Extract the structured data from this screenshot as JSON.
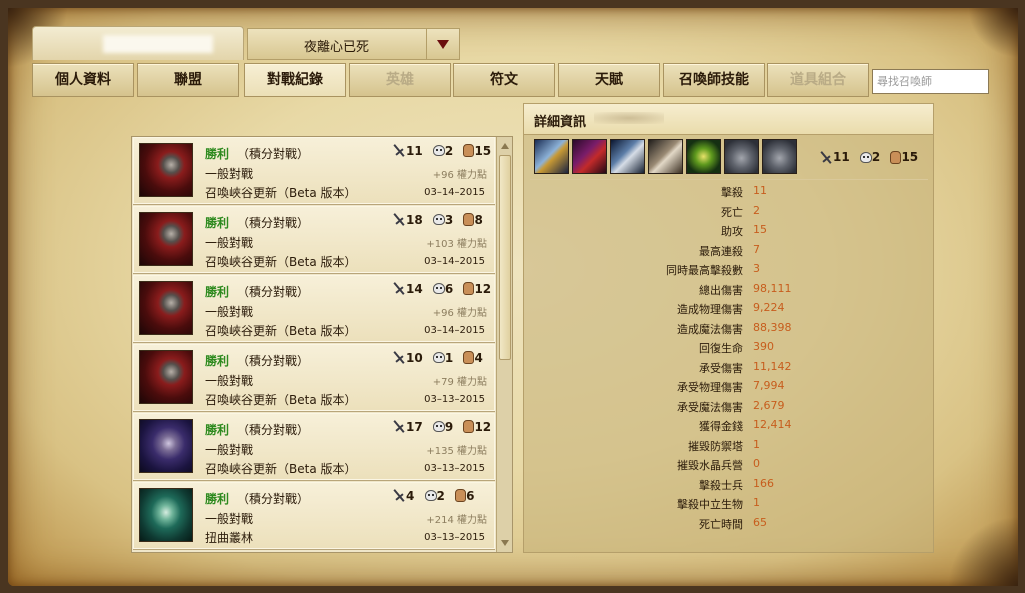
{
  "header": {
    "summoner_name": "夜離心已死"
  },
  "nav": {
    "tabs": [
      {
        "label": "個人資料",
        "state": "normal"
      },
      {
        "label": "聯盟",
        "state": "normal"
      },
      {
        "label": "對戰紀錄",
        "state": "active"
      },
      {
        "label": "英雄",
        "state": "disabled"
      },
      {
        "label": "符文",
        "state": "normal"
      },
      {
        "label": "天賦",
        "state": "normal"
      },
      {
        "label": "召喚師技能",
        "state": "normal"
      },
      {
        "label": "道具組合",
        "state": "disabled"
      }
    ],
    "search_placeholder": "尋找召喚師"
  },
  "matches": [
    {
      "result": "勝利",
      "mode": "（積分對戰）",
      "queue": "一般對戰",
      "map": "召喚峽谷更新（Beta 版本）",
      "kills": "11",
      "deaths": "2",
      "assists": "15",
      "ip": "+96 權力點",
      "date": "03–14–2015",
      "portrait": "red-hair-champion-portrait"
    },
    {
      "result": "勝利",
      "mode": "（積分對戰）",
      "queue": "一般對戰",
      "map": "召喚峽谷更新（Beta 版本）",
      "kills": "18",
      "deaths": "3",
      "assists": "8",
      "ip": "+103 權力點",
      "date": "03–14–2015",
      "portrait": "red-hair-champion-portrait"
    },
    {
      "result": "勝利",
      "mode": "（積分對戰）",
      "queue": "一般對戰",
      "map": "召喚峽谷更新（Beta 版本）",
      "kills": "14",
      "deaths": "6",
      "assists": "12",
      "ip": "+96 權力點",
      "date": "03–14–2015",
      "portrait": "red-hair-champion-portrait"
    },
    {
      "result": "勝利",
      "mode": "（積分對戰）",
      "queue": "一般對戰",
      "map": "召喚峽谷更新（Beta 版本）",
      "kills": "10",
      "deaths": "1",
      "assists": "4",
      "ip": "+79 權力點",
      "date": "03–13–2015",
      "portrait": "red-hair-champion-portrait"
    },
    {
      "result": "勝利",
      "mode": "（積分對戰）",
      "queue": "一般對戰",
      "map": "召喚峽谷更新（Beta 版本）",
      "kills": "17",
      "deaths": "9",
      "assists": "12",
      "ip": "+135 權力點",
      "date": "03–13–2015",
      "portrait": "purple-hair-champion-portrait"
    },
    {
      "result": "勝利",
      "mode": "（積分對戰）",
      "queue": "一般對戰",
      "map": "扭曲叢林",
      "kills": "4",
      "deaths": "2",
      "assists": "6",
      "ip": "+214 權力點",
      "date": "03–13–2015",
      "portrait": "green-champion-portrait"
    }
  ],
  "details": {
    "title": "詳細資訊",
    "items": [
      "hourglass-item-icon",
      "cape-item-icon",
      "wand-item-icon",
      "boots-item-icon",
      "staff-item-icon",
      "pouch-item-icon",
      "pouch-item-icon"
    ],
    "kills": "11",
    "deaths": "2",
    "assists": "15",
    "stats": [
      {
        "label": "擊殺",
        "value": "11"
      },
      {
        "label": "死亡",
        "value": "2"
      },
      {
        "label": "助攻",
        "value": "15"
      },
      {
        "label": "最高連殺",
        "value": "7"
      },
      {
        "label": "同時最高擊殺數",
        "value": "3"
      },
      {
        "label": "總出傷害",
        "value": "98,111"
      },
      {
        "label": "造成物理傷害",
        "value": "9,224"
      },
      {
        "label": "造成魔法傷害",
        "value": "88,398"
      },
      {
        "label": "回復生命",
        "value": "390"
      },
      {
        "label": "承受傷害",
        "value": "11,142"
      },
      {
        "label": "承受物理傷害",
        "value": "7,994"
      },
      {
        "label": "承受魔法傷害",
        "value": "2,679"
      },
      {
        "label": "獲得金錢",
        "value": "12,414"
      },
      {
        "label": "摧毀防禦塔",
        "value": "1"
      },
      {
        "label": "摧毀水晶兵營",
        "value": "0"
      },
      {
        "label": "擊殺士兵",
        "value": "166"
      },
      {
        "label": "擊殺中立生物",
        "value": "1"
      },
      {
        "label": "死亡時間",
        "value": "65"
      }
    ]
  },
  "colors": {
    "win_text": "#2e8a1f",
    "stat_value": "#c75d1d",
    "parchment": "#e8d9a6"
  }
}
